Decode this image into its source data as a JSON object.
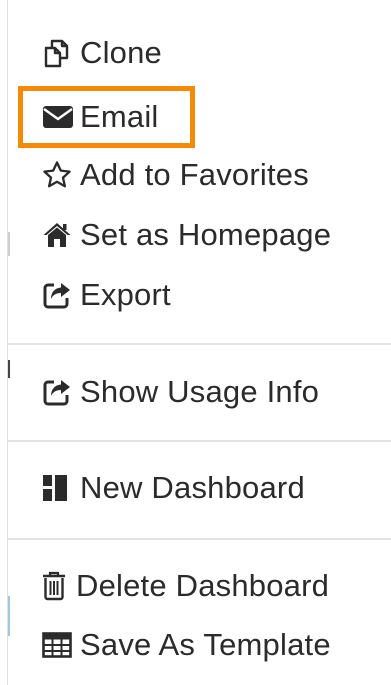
{
  "menu": {
    "items": [
      {
        "id": "clone",
        "label": "Clone",
        "icon": "clone-icon"
      },
      {
        "id": "email",
        "label": "Email",
        "icon": "envelope-icon"
      },
      {
        "id": "favorites",
        "label": "Add to Favorites",
        "icon": "star-outline-icon"
      },
      {
        "id": "homepage",
        "label": "Set as Homepage",
        "icon": "home-icon"
      },
      {
        "id": "export",
        "label": "Export",
        "icon": "share-square-icon"
      },
      {
        "id": "usage",
        "label": "Show Usage Info",
        "icon": "share-square-icon"
      },
      {
        "id": "new-dashboard",
        "label": "New Dashboard",
        "icon": "dashboard-layout-icon"
      },
      {
        "id": "delete-dashboard",
        "label": "Delete Dashboard",
        "icon": "trash-icon"
      },
      {
        "id": "save-template",
        "label": "Save As Template",
        "icon": "table-grid-icon"
      }
    ]
  },
  "colors": {
    "highlight": "#f58a07",
    "text": "#2b2b2b",
    "divider": "#e4e4e4"
  }
}
